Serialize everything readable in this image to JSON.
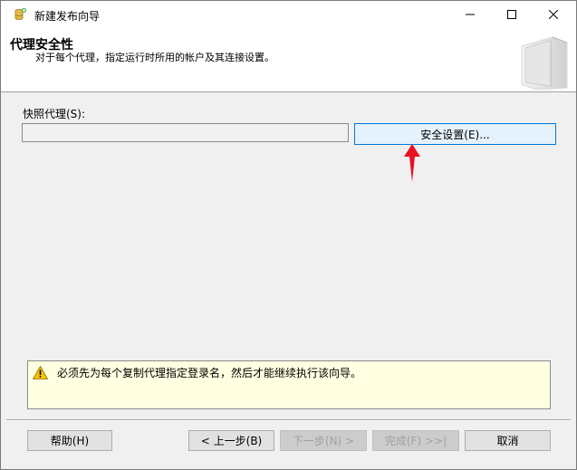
{
  "window": {
    "title": "新建发布向导"
  },
  "header": {
    "title": "代理安全性",
    "subtitle": "对于每个代理，指定运行时所用的帐户及其连接设置。"
  },
  "snapshot_agent": {
    "label": "快照代理(S):",
    "value": "",
    "security_button_label": "安全设置(E)..."
  },
  "message": {
    "icon": "warning-icon",
    "text": "必须先为每个复制代理指定登录名，然后才能继续执行该向导。"
  },
  "footer": {
    "help_label": "帮助(H)",
    "back_label": "< 上一步(B)",
    "next_label": "下一步(N) >",
    "finish_label": "完成(F) >>|",
    "cancel_label": "取消"
  },
  "colors": {
    "accent": "#0078d7",
    "annotation_arrow": "#e81123",
    "message_background": "#ffffe1"
  }
}
